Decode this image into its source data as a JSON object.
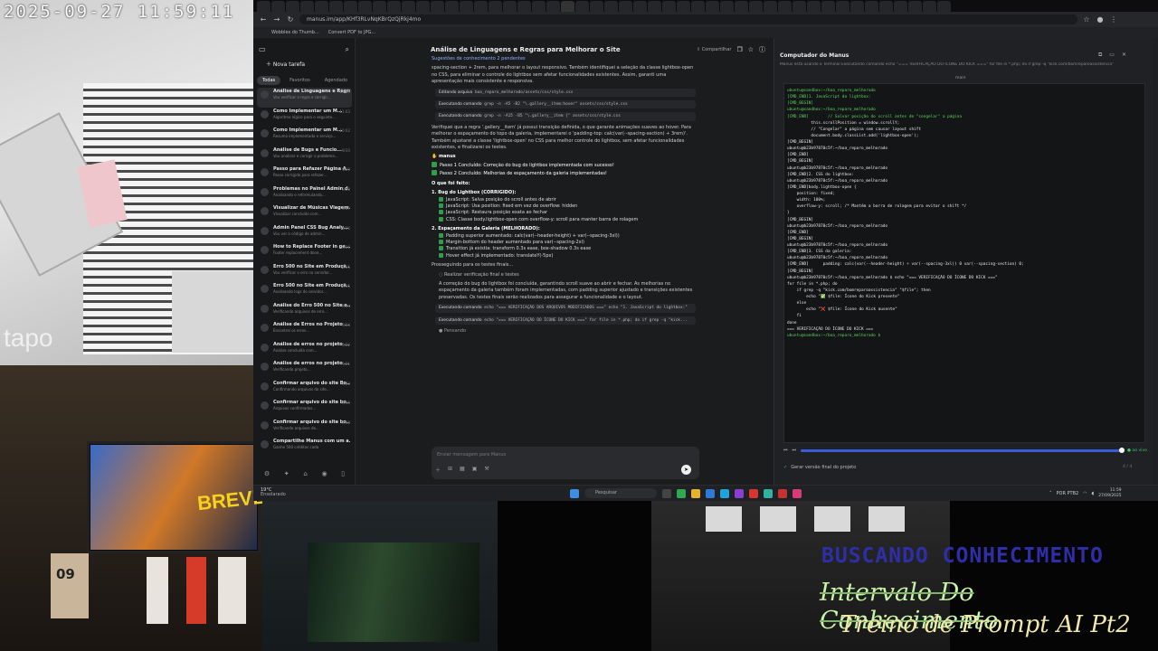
{
  "camera": {
    "timestamp": "2025-09-27  11:59:11",
    "brand": "tapo",
    "screen_brand": "BREVE!",
    "calendar_day": "09"
  },
  "overlay": {
    "line1": "BUSCANDO CONHECIMENTO",
    "line2": "Intervalo Do Conhecimento",
    "line3": "Treino de Prompt AI Pt2"
  },
  "browser": {
    "url": "manus.im/app/KHf3RLvNqKBrQzQjRkj4mo",
    "bookmarks": [
      "Wobbles do Thumb...",
      "Convert PDF to JPG..."
    ],
    "tab_count": 48
  },
  "sidebar": {
    "new_task": "Nova tarefa",
    "new_task_shortcut": "Ctrl K",
    "tabs": [
      "Todas",
      "Favoritos",
      "Agendado"
    ],
    "items": [
      {
        "title": "Análise de Linguagens e Regra...",
        "sub": "Vou verificar a regra e corrigir...",
        "time": "11:59"
      },
      {
        "title": "Como Implementar um M...",
        "sub": "Algoritmo lógico para o seguinte...",
        "time": "11:03"
      },
      {
        "title": "Como Implementar um M...",
        "sub": "Resumo implementado e serviço...",
        "time": "10:02"
      },
      {
        "title": "Análise de Bugs e Funcio...",
        "sub": "Vou analisar e corrigir o problema...",
        "time": "9/30"
      },
      {
        "title": "Passo para Refazer Página A...",
        "sub": "Passo corrigido para refazer...",
        "time": "9/29"
      },
      {
        "title": "Problemas no Painel Admin d...",
        "sub": "Analisando e reformulando...",
        "time": "9/28"
      },
      {
        "title": "Visualizar de Músicas Viagem...",
        "sub": "Visualizar concluído com...",
        "time": "9/27"
      },
      {
        "title": "Admin Panel CSS Bug Analy...",
        "sub": "Vou ver o código de admin...",
        "time": "9/26"
      },
      {
        "title": "How to Replace Footer in ge...",
        "sub": "Footer replacement done...",
        "time": "9/26"
      },
      {
        "title": "Erro 500 no Site em Produçã...",
        "sub": "Vou verificar o erro no servidor...",
        "time": "9/25"
      },
      {
        "title": "Erro 500 no Site em Produçã...",
        "sub": "Analisando logs do servidor...",
        "time": "9/25"
      },
      {
        "title": "Análise do Erro 500 no Site e...",
        "sub": "Verificando arquivos de erro...",
        "time": "9/24"
      },
      {
        "title": "Análise de Erros no Projeto ...",
        "sub": "Encontrei os erros...",
        "time": "9/23"
      },
      {
        "title": "Análise de erros no projeto ...",
        "sub": "Análise concluída com...",
        "time": "9/22"
      },
      {
        "title": "Análise de erros no projeto ...",
        "sub": "Verificando projeto...",
        "time": "9/21"
      },
      {
        "title": "Confirmar arquivo do site Bo...",
        "sub": "Confirmando arquivos do site...",
        "time": "9/20"
      },
      {
        "title": "Confirmar arquivo do site bo...",
        "sub": "Arquivos confirmados...",
        "time": "9/19"
      },
      {
        "title": "Confirmar arquivo do site bo...",
        "sub": "Verificando arquivos do...",
        "time": "9/18"
      },
      {
        "title": "Compartilhe Manus com um a...",
        "sub": "Ganhe 500 créditos cada",
        "time": ""
      }
    ]
  },
  "chat": {
    "title": "Análise de Linguagens e Regras para Melhorar o Site",
    "share": "Compartilhar",
    "intro_line": "Sugestões de conhecimento  2 pendentes",
    "para1": "spacing-section + 2rem, para melhorar o layout responsivo. Também identifiquei a seleção da classe lightbox-open no CSS, para eliminar o controle do lightbox sem afetar funcionalidades existentes. Assim, garanti uma apresentação mais consistente e responsiva.",
    "cmd1_label": "Editando arquivo",
    "cmd1": "boa_reparo_melhorado/assets/css/style.css",
    "cmd2_label": "Executando comando",
    "cmd2": "grep -n -A5 -B2 \"\\.gallery__item:hover\" assets/css/style.css",
    "cmd3_label": "Executando comando",
    "cmd3": "grep -n -A15 -B5 \"\\.gallery__item {\" assets/css/style.css",
    "para2": "Verifiquei que a regra '.gallery__item' já possui transição definida, o que garante animações suaves ao hover. Para melhorar o espaçamento do topo da galeria, implementarei o 'padding-top: calc(var(--spacing-section) + 3rem)'. Também ajustarei a classe 'lightbox-open' no CSS para melhor controle do lightbox, sem afetar funcionalidades existentes, e finalizarei os testes.",
    "manus": "manus",
    "step1": "Passo 1 Concluído: Correção do bug do lightbox implementada com sucesso!",
    "step2": "Passo 2 Concluído: Melhorias de espaçamento da galeria implementadas!",
    "done_head": "O que foi feito:",
    "sec1": "1. Bug do Lightbox (CORRIGIDO):",
    "sec1_items": [
      "JavaScript: Salva posição do scroll antes de abrir",
      "JavaScript: Usa position: fixed em vez de overflow: hidden",
      "JavaScript: Restaura posição exata ao fechar",
      "CSS: Classe body.lightbox-open com overflow-y: scroll para manter barra de rolagem"
    ],
    "sec2": "2. Espaçamento da Galeria (MELHORADO):",
    "sec2_items": [
      "Padding superior aumentado: calc(var(--header-height) + var(--spacing-3xl))",
      "Margin-bottom do header aumentado para var(--spacing-2xl)",
      "Transition já existia: transform 0.3s ease, box-shadow 0.3s ease",
      "Hover effect já implementado: translateY(-5px)"
    ],
    "proceed": "Prosseguindo para os testes finais...",
    "sub_head": "Realizar verificação final e testes",
    "para3": "A correção do bug do lightbox foi concluída, garantindo scroll suave ao abrir e fechar. As melhorias no espaçamento da galeria também foram implementadas, com padding superior ajustado e transições existentes preservadas. Os testes finais serão realizados para assegurar a funcionalidade e o layout.",
    "cmd4_label": "Executando comando",
    "cmd4": "echo \"=== VERIFICAÇÃO DOS ARQUIVOS MODIFICADOS ===\" echo \"1. JavaScript do lightbox:\"",
    "cmd5_label": "Executando comando",
    "cmd5": "echo \"=== VERIFICAÇÃO DO ÍCONE DO KICK ===\" for file in *.php; do if grep -q \"kick...",
    "thinking": "Pensando",
    "input_placeholder": "Enviar mensagem para Manus"
  },
  "panel": {
    "title": "Computador do Manus",
    "subtitle": "Manus está usando o Terminal   Executando comando  echo \"=== VERIFICAÇÃO DO ÍCONE DO KICK ===\" for file in *.php; do if grep -q \"kick.com/bomreparoassistencia\"",
    "tab": "main",
    "terminal_lines": [
      {
        "t": "ubuntu@sandbox:~/boa_reparo_melhorado",
        "c": "g"
      },
      {
        "t": "[CMD_END]1. JavaScript do lightbox:",
        "c": "g"
      },
      {
        "t": "[CMD_BEGIN]",
        "c": "g"
      },
      {
        "t": "ubuntu@sandbox:~/boa_reparo_melhorado",
        "c": "g"
      },
      {
        "t": "[CMD_END]        // Salvar posição do scroll antes de \"congelar\" a página",
        "c": "g"
      },
      {
        "t": "          this.scrollPosition = window.scrollY;",
        "c": "y"
      },
      {
        "t": "",
        "c": "y"
      },
      {
        "t": "          // \"Congelar\" a página sem causar layout shift",
        "c": "y"
      },
      {
        "t": "          document.body.classList.add('lightbox-open');",
        "c": "y"
      },
      {
        "t": "[CMD_BEGIN]",
        "c": "y"
      },
      {
        "t": "ubuntu@b23b97870c5f:~/boa_reparo_melhorado",
        "c": "y"
      },
      {
        "t": "[CMD_END]",
        "c": "y"
      },
      {
        "t": "[CMD_BEGIN]",
        "c": "y"
      },
      {
        "t": "ubuntu@b23b97870c5f:~/boa_reparo_melhorado",
        "c": "y"
      },
      {
        "t": "[CMD_END]2. CSS do lightbox:",
        "c": "y"
      },
      {
        "t": "ubuntu@b23b97870c5f:~/boa_reparo_melhorado",
        "c": "y"
      },
      {
        "t": "[CMD_END]body.lightbox-open {",
        "c": "y"
      },
      {
        "t": "    position: fixed;",
        "c": "y"
      },
      {
        "t": "    width: 100%;",
        "c": "y"
      },
      {
        "t": "    overflow-y: scroll; /* Mantém a barra de rolagem para evitar o shift */",
        "c": "y"
      },
      {
        "t": "}",
        "c": "y"
      },
      {
        "t": "[CMD_BEGIN]",
        "c": "y"
      },
      {
        "t": "ubuntu@b23b97870c5f:~/boa_reparo_melhorado",
        "c": "y"
      },
      {
        "t": "[CMD_END]",
        "c": "y"
      },
      {
        "t": "[CMD_BEGIN]",
        "c": "y"
      },
      {
        "t": "ubuntu@b23b97870c5f:~/boa_reparo_melhorado",
        "c": "y"
      },
      {
        "t": "[CMD_END]3. CSS da galeria:",
        "c": "y"
      },
      {
        "t": "ubuntu@b23b97870c5f:~/boa_reparo_melhorado",
        "c": "y"
      },
      {
        "t": "[CMD_END]      padding: calc(var(--header-height) + var(--spacing-3xl)) 0 var(--spacing-section) 0;",
        "c": "y"
      },
      {
        "t": "",
        "c": "y"
      },
      {
        "t": "[CMD_BEGIN]",
        "c": "y"
      },
      {
        "t": "ubuntu@b23b97870c5f:~/boa_reparo_melhorado $ echo \"=== VERIFICAÇÃO DO ÍCONE DO KICK ===\"",
        "c": "y"
      },
      {
        "t": "for file in *.php; do",
        "c": "y"
      },
      {
        "t": "    if grep -q \"kick.com/bomreparoassistencia\" \"$file\"; then",
        "c": "y"
      },
      {
        "t": "        echo \"✅ $file: Ícone do Kick presente\"",
        "c": "y"
      },
      {
        "t": "    else",
        "c": "y"
      },
      {
        "t": "        echo \"❌ $file: Ícone do Kick ausente\"",
        "c": "y"
      },
      {
        "t": "    fi",
        "c": "y"
      },
      {
        "t": "done",
        "c": "y"
      },
      {
        "t": "=== VERIFICAÇÃO DO ÍCONE DO KICK ===",
        "c": "y"
      },
      {
        "t": "ubuntu@sandbox:~/boa_reparo_melhorado $",
        "c": "g"
      }
    ],
    "live": "ao vivo",
    "footer": "Gerar versão final do projeto",
    "count": "4 / 4"
  },
  "taskbar": {
    "weather_temp": "19°C",
    "weather_desc": "Ensolarado",
    "search": "Pesquisar",
    "lang": "POR PTB2",
    "time": "11:59",
    "date": "27/09/2025"
  }
}
